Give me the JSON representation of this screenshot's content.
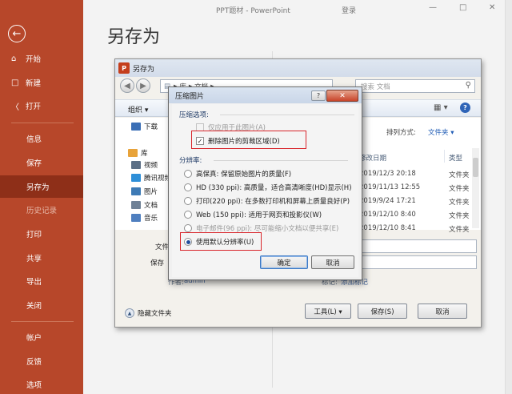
{
  "sidebar": {
    "back_icon": "back-arrow-icon",
    "items": [
      {
        "label": "开始",
        "icon": "home-icon"
      },
      {
        "label": "新建",
        "icon": "new-document-icon"
      },
      {
        "label": "打开",
        "icon": "open-folder-icon"
      },
      {
        "label": "信息"
      },
      {
        "label": "保存"
      },
      {
        "label": "另存为"
      },
      {
        "label": "历史记录"
      },
      {
        "label": "打印"
      },
      {
        "label": "共享"
      },
      {
        "label": "导出"
      },
      {
        "label": "关闭"
      },
      {
        "label": "帐户"
      },
      {
        "label": "反馈"
      },
      {
        "label": "选项"
      }
    ],
    "colors": {
      "background": "#b7472a",
      "active": "#8e2f18"
    }
  },
  "titlebar": {
    "app_title": "PPT题材 - PowerPoint",
    "login": "登录",
    "minimize": "—",
    "restore": "□",
    "close": "✕"
  },
  "backstage": {
    "heading": "另存为"
  },
  "save_as": {
    "title": "另存为",
    "logo_letter": "P",
    "address_parts": [
      "库",
      "文档"
    ],
    "search_placeholder": "搜索 文档",
    "organize_label": "组织 ▾",
    "sort_label": "排列方式:",
    "sort_value": "文件夹 ▾",
    "columns": {
      "date": "修改日期",
      "type": "类型"
    },
    "nav": [
      {
        "label": "下载",
        "color": "#3b6fb6"
      },
      {
        "label": "库",
        "color": "#e8a33a"
      },
      {
        "label": "视频",
        "color": "#5b6f86"
      },
      {
        "label": "腾讯视频",
        "color": "#2e8fd8"
      },
      {
        "label": "图片",
        "color": "#3d7ab5"
      },
      {
        "label": "文档",
        "color": "#6f8196"
      },
      {
        "label": "音乐",
        "color": "#4f7fbf"
      }
    ],
    "files": [
      {
        "date": "2019/12/3 20:18",
        "type": "文件夹"
      },
      {
        "date": "2019/11/13 12:55",
        "type": "文件夹"
      },
      {
        "date": "2019/9/24 17:21",
        "type": "文件夹"
      },
      {
        "date": "2019/12/10 8:40",
        "type": "文件夹"
      },
      {
        "date": "2019/12/10 8:41",
        "type": "文件夹"
      }
    ],
    "filename_label": "文件",
    "savetype_label": "保存",
    "author_label": "作者:",
    "author_value": "admin",
    "tags_label": "标记:",
    "tags_value": "添加标记",
    "hide_folders": "隐藏文件夹",
    "tools_button": "工具(L)  ▾",
    "save_button": "保存(S)",
    "cancel_button": "取消"
  },
  "compress": {
    "title": "压缩图片",
    "help": "?",
    "close": "✕",
    "section_options": "压缩选项:",
    "only_this_picture": "仅应用于此图片(A)",
    "delete_cropped": "删除图片的剪裁区域(D)",
    "section_resolution": "分辨率:",
    "resolutions": [
      {
        "label": "高保真: 保留原始图片的质量(F)",
        "selected": false,
        "enabled": true
      },
      {
        "label": "HD (330 ppi): 高质量，适合高清晰度(HD)显示(H)",
        "selected": false,
        "enabled": true
      },
      {
        "label": "打印(220 ppi): 在多数打印机和屏幕上质量良好(P)",
        "selected": false,
        "enabled": true
      },
      {
        "label": "Web (150 ppi): 适用于网页和投影仪(W)",
        "selected": false,
        "enabled": true
      },
      {
        "label": "电子邮件(96 ppi): 尽可能缩小文档以便共享(E)",
        "selected": false,
        "enabled": false
      },
      {
        "label": "使用默认分辨率(U)",
        "selected": true,
        "enabled": true
      }
    ],
    "ok": "确定",
    "cancel": "取消",
    "highlight_color": "#d8252b"
  }
}
